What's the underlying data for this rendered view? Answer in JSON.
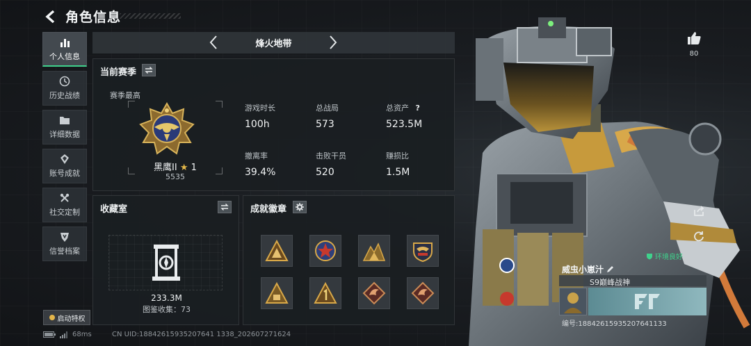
{
  "header": {
    "title": "角色信息"
  },
  "nav": {
    "items": [
      {
        "label": "个人信息",
        "icon": "bar-chart-icon",
        "active": true
      },
      {
        "label": "历史战绩",
        "icon": "clock-icon"
      },
      {
        "label": "详细数据",
        "icon": "folder-icon"
      },
      {
        "label": "账号成就",
        "icon": "achievement-icon"
      },
      {
        "label": "社交定制",
        "icon": "tools-icon"
      },
      {
        "label": "信誉档案",
        "icon": "shield-icon"
      }
    ],
    "perk_label": "启动特权"
  },
  "mode": {
    "name": "烽火地带"
  },
  "season": {
    "title": "当前赛季",
    "best_label": "赛季最高",
    "rank_name": "黑鹰II",
    "rank_stars": "1",
    "rank_score": "5535",
    "stats": [
      {
        "label": "游戏时长",
        "value": "100h"
      },
      {
        "label": "总战局",
        "value": "573"
      },
      {
        "label": "总资产",
        "value": "523.5M",
        "help": "?"
      },
      {
        "label": "撤离率",
        "value": "39.4%"
      },
      {
        "label": "击败干员",
        "value": "520"
      },
      {
        "label": "赚损比",
        "value": "1.5M"
      }
    ]
  },
  "collection": {
    "title": "收藏室",
    "value": "233.3M",
    "count_text": "图鉴收集：73"
  },
  "badges": {
    "title": "成就徽章",
    "items": [
      "triangle-badge-icon",
      "star-medal-icon",
      "mountain-badge-icon",
      "eagle-shield-icon",
      "pyramid-badge-icon",
      "number-one-badge-icon",
      "dragon-badge-icon",
      "dragon-badge-icon"
    ]
  },
  "footer": {
    "ping": "68ms",
    "uid": "CN UID:18842615935207641 1338_202607271624"
  },
  "character": {
    "likes": "80",
    "env_tag": "环境良好",
    "name": "威虫小崽汁",
    "title": "S9巅峰战神",
    "id_text": "编号:18842615935207641133"
  },
  "colors": {
    "accent": "#3fd28c",
    "gold": "#c9a24a"
  }
}
